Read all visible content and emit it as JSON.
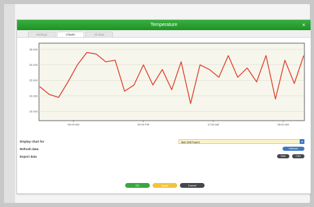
{
  "window": {
    "title": "Temperature",
    "close_glyph": "×"
  },
  "tabs": [
    {
      "label": "Settings"
    },
    {
      "label": "Charts"
    },
    {
      "label": "All data"
    }
  ],
  "chart_data": {
    "type": "line",
    "x_ticks": [
      "06:00 AM",
      "06:00 PM",
      "12:00 AM",
      "06:00 AM"
    ],
    "y_ticks": [
      "35.000",
      "30.000",
      "25.000",
      "20.000",
      "15.000"
    ],
    "ylim": [
      12,
      37
    ],
    "line_color": "#e03c2a",
    "values": [
      23.0,
      20.5,
      19.5,
      24.5,
      30.0,
      34.0,
      33.5,
      31.0,
      31.5,
      21.5,
      23.5,
      30.0,
      23.5,
      28.5,
      22.0,
      31.0,
      17.5,
      30.0,
      28.5,
      26.0,
      33.0,
      26.0,
      29.0,
      24.5,
      33.0,
      19.0,
      31.5,
      24.0,
      33.0
    ]
  },
  "controls": {
    "display_label": "Display chart for",
    "display_value": "last 100 hours",
    "refresh_label": "Refresh data",
    "refresh_button": "Refresh",
    "export_label": "Export data",
    "export_buttons": [
      "XML",
      "CSV"
    ]
  },
  "footer": {
    "ok": "OK",
    "apply": "Apply",
    "cancel": "Cancel"
  },
  "colors": {
    "title_green": "#2ba132",
    "ok_green": "#3aa63f",
    "apply_yellow": "#f2c33a",
    "cancel_dark": "#45474c",
    "refresh_blue": "#3f78c4"
  }
}
